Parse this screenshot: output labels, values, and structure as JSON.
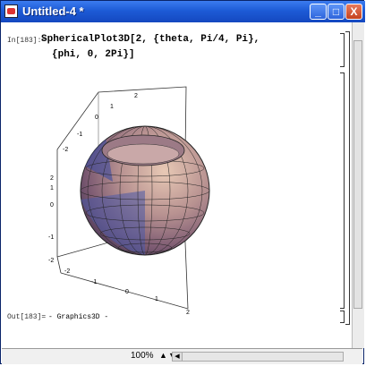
{
  "window": {
    "title": "Untitled-4 *"
  },
  "titlebar_buttons": {
    "minimize": "_",
    "maximize": "□",
    "close": "X"
  },
  "cells": {
    "input_label": "In[183]:=",
    "code_line1": "SphericalPlot3D[2, {theta, Pi/4, Pi},",
    "code_line2": "{phi, 0, 2Pi}]",
    "output_label": "Out[183]=",
    "output_value": "- Graphics3D -"
  },
  "plot": {
    "z_ticks": [
      "2",
      "1",
      "0",
      "-1",
      "-2"
    ],
    "y_ticks": [
      "2",
      "1",
      "0",
      "-1",
      "-2"
    ],
    "x_ticks": [
      "-2",
      "-1",
      "0",
      "1",
      "2"
    ]
  },
  "status": {
    "zoom": "100%"
  },
  "colors": {
    "titlebar": "#1d5bd6",
    "surface_light": "#d9b6a6",
    "surface_dark": "#6a4a62",
    "surface_blue": "#4a5aa8"
  }
}
